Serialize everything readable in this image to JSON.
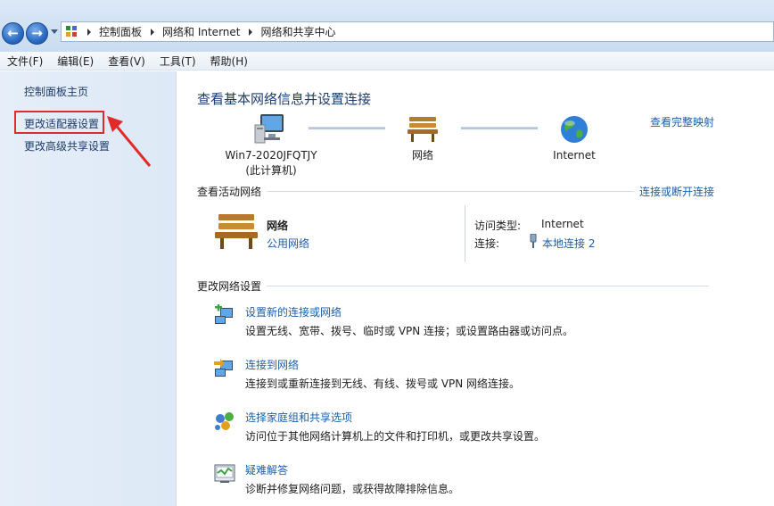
{
  "breadcrumb": {
    "items": [
      "控制面板",
      "网络和 Internet",
      "网络和共享中心"
    ]
  },
  "menu": {
    "items": [
      "文件(F)",
      "编辑(E)",
      "查看(V)",
      "工具(T)",
      "帮助(H)"
    ]
  },
  "sidebar": {
    "home": "控制面板主页",
    "adapter": "更改适配器设置",
    "advanced": "更改高级共享设置"
  },
  "main": {
    "title": "查看基本网络信息并设置连接",
    "full_map": "查看完整映射",
    "map": {
      "computer_name": "Win7-2020JFQTJY",
      "computer_sub": "(此计算机)",
      "network": "网络",
      "internet": "Internet"
    },
    "active": {
      "heading": "查看活动网络",
      "connect_link": "连接或断开连接",
      "name": "网络",
      "type": "公用网络",
      "access_label": "访问类型:",
      "access_value": "Internet",
      "conn_label": "连接:",
      "conn_value": "本地连接 2"
    },
    "change": {
      "heading": "更改网络设置",
      "tasks": [
        {
          "title": "设置新的连接或网络",
          "desc": "设置无线、宽带、拨号、临时或 VPN 连接；或设置路由器或访问点。"
        },
        {
          "title": "连接到网络",
          "desc": "连接到或重新连接到无线、有线、拨号或 VPN 网络连接。"
        },
        {
          "title": "选择家庭组和共享选项",
          "desc": "访问位于其他网络计算机上的文件和打印机，或更改共享设置。"
        },
        {
          "title": "疑难解答",
          "desc": "诊断并修复网络问题，或获得故障排除信息。"
        }
      ]
    }
  },
  "colors": {
    "link": "#1f5fa9",
    "highlight": "#e12a2a"
  }
}
